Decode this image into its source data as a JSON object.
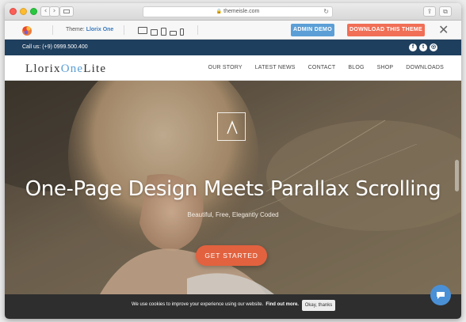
{
  "browser": {
    "url": "themeisle.com",
    "back_glyph": "‹",
    "forward_glyph": "›",
    "reload_glyph": "↻",
    "share_glyph": "⇪",
    "tabs_glyph": "⧉"
  },
  "demobar": {
    "theme_prefix": "Theme:",
    "theme_name": "Llorix One",
    "admin_demo_label": "ADMIN DEMO",
    "download_label": "DOWNLOAD THIS THEME",
    "close_glyph": "✕",
    "colors": {
      "admin": "#5b9fd6",
      "download": "#f06f56"
    }
  },
  "site": {
    "phone": "Call us: (+9) 0999.500.400",
    "social": [
      {
        "name": "facebook-icon",
        "glyph": "f"
      },
      {
        "name": "twitter-icon",
        "glyph": "t"
      },
      {
        "name": "instagram-icon",
        "glyph": "◎"
      }
    ],
    "brand_prefix": "Llorix",
    "brand_one": "One",
    "brand_suffix": "Lite",
    "menu": [
      "OUR STORY",
      "LATEST NEWS",
      "CONTACT",
      "BLOG",
      "SHOP",
      "DOWNLOADS"
    ],
    "colors": {
      "topbar": "#1f3f5e",
      "accent": "#5b9fd6",
      "cta": "#e2623f"
    }
  },
  "hero": {
    "title": "One-Page Design Meets Parallax Scrolling",
    "subtitle": "Beautiful, Free, Elegantly Coded",
    "cta_label": "GET STARTED"
  },
  "cookie": {
    "text": "We use cookies to improve your experience using our website.",
    "more_label": "Find out more.",
    "ok_label": "Okay, thanks"
  }
}
